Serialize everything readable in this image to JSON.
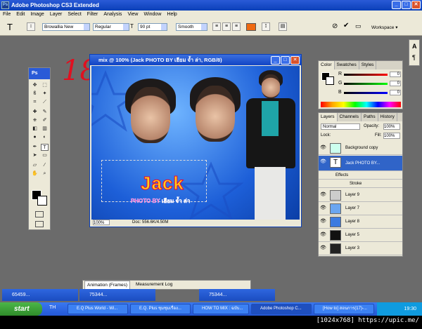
{
  "app": {
    "title": "Adobe Photoshop CS3 Extended"
  },
  "menu": [
    "File",
    "Edit",
    "Image",
    "Layer",
    "Select",
    "Filter",
    "Analysis",
    "View",
    "Window",
    "Help"
  ],
  "options": {
    "font_family": "Browallia New",
    "font_style": "Regular",
    "font_size": "90 pt",
    "antialias": "Smooth",
    "workspace": "Workspace ▾"
  },
  "toolbox": {
    "title": "Ps"
  },
  "annotation": "18",
  "document": {
    "title": "mix @ 100% (Jack PHOTO BY เฮียม จ้ำ ล่า, RGB/8)",
    "zoom": "100%",
    "doc_info": "Doc: 556.6K/4.50M",
    "text_main": "Jack",
    "text_sub": "PHOTO BY เฮียม จ้ำ ล่า"
  },
  "color_panel": {
    "tabs": [
      "Color",
      "Swatches",
      "Styles"
    ],
    "r": {
      "label": "R",
      "value": "0"
    },
    "g": {
      "label": "G",
      "value": "0"
    },
    "b": {
      "label": "B",
      "value": "0"
    }
  },
  "layers_panel": {
    "tabs": [
      "Layers",
      "Channels",
      "Paths",
      "History"
    ],
    "blend": "Normal",
    "opacity_label": "Opacity:",
    "opacity": "100%",
    "lock_label": "Lock:",
    "fill_label": "Fill:",
    "fill": "100%",
    "layers": [
      "Background copy",
      "Jack PHOTO BY...",
      "Effects",
      "Stroke",
      "Layer 9",
      "Layer 7",
      "Layer 8",
      "Layer 5",
      "Layer 3"
    ]
  },
  "anim_panel": {
    "tab1": "Animation (Frames)",
    "tab2": "Measurement Log"
  },
  "minimized": [
    "65459...",
    "75344...",
    "75344..."
  ],
  "taskbar": {
    "start": "start",
    "lang": "TH",
    "items": [
      "E.Q Plus World - Wi...",
      "E.Q. Plus ชุมชุมเรื่อง...",
      "HOW TO MIX : ฉบับ...",
      "Adobe Photoshop C...",
      "[How to] สอนการ(17)-..."
    ],
    "clock": "19:30"
  },
  "watermark": "[1024x768] https://upic.me/"
}
